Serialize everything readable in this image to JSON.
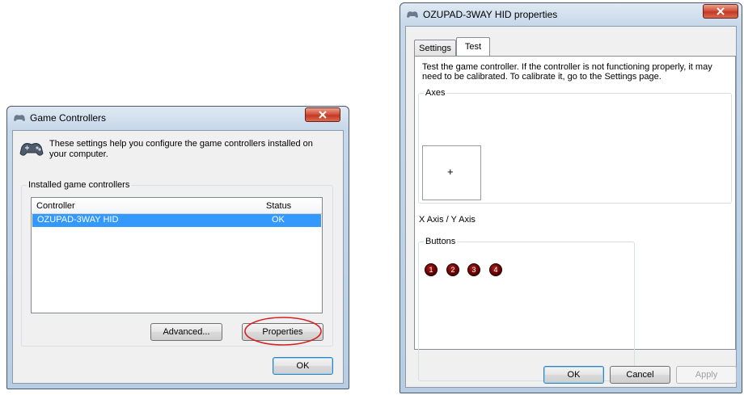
{
  "game_controllers": {
    "title": "Game Controllers",
    "description": "These settings help you configure the game controllers installed on your computer.",
    "group_label": "Installed game controllers",
    "columns": [
      "Controller",
      "Status"
    ],
    "rows": [
      {
        "controller": "OZUPAD-3WAY HID",
        "status": "OK"
      }
    ],
    "advanced_label": "Advanced...",
    "properties_label": "Properties",
    "ok_label": "OK",
    "highlight_color": "#d62020"
  },
  "properties": {
    "title": "OZUPAD-3WAY HID properties",
    "tabs": [
      {
        "label": "Settings"
      },
      {
        "label": "Test"
      }
    ],
    "active_tab": "Test",
    "instructions": "Test the game controller.  If the controller is not functioning properly, it may need to be calibrated.  To calibrate it, go to the Settings page.",
    "axes_label": "Axes",
    "crosshair": "+",
    "axis_caption": "X Axis / Y Axis",
    "buttons_label": "Buttons",
    "buttons": [
      "1",
      "2",
      "3",
      "4"
    ],
    "ok_label": "OK",
    "cancel_label": "Cancel",
    "apply_label": "Apply"
  }
}
